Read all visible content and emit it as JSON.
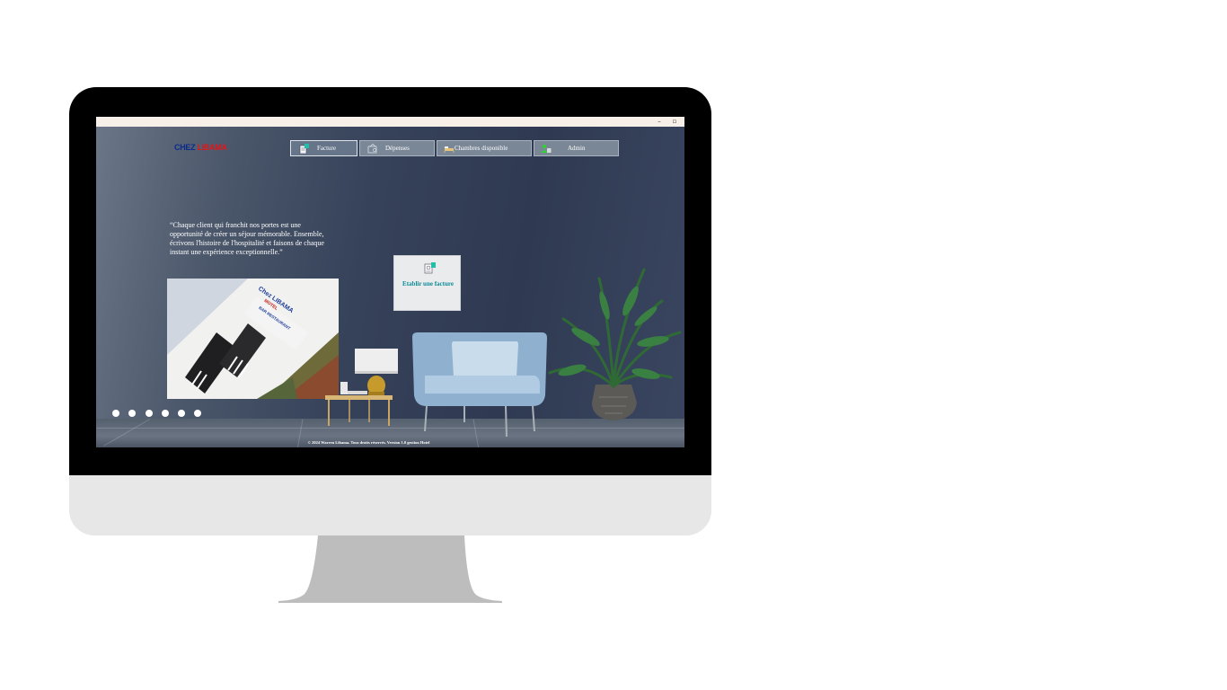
{
  "window": {
    "minimize_glyph": "–",
    "restore_glyph": "▫"
  },
  "logo": {
    "part1": "CHEZ",
    "part2": "LIBAMA"
  },
  "nav": {
    "items": [
      {
        "label": "Facture",
        "icon": "invoice-icon",
        "active": true
      },
      {
        "label": "Dépenses",
        "icon": "expenses-icon",
        "active": false
      },
      {
        "label": "Chambres disponible",
        "icon": "bed-icon",
        "active": false
      },
      {
        "label": "Admin",
        "icon": "admin-icon",
        "active": false
      }
    ]
  },
  "quote": {
    "text": "“Chaque client qui franchit nos portes est une opportunité de créer un séjour mémorable. Ensemble, écrivons l'histoire de l'hospitalité et faisons de chaque instant une expérience exceptionnelle.”"
  },
  "photo": {
    "sign_line1": "Chez LIBAMA",
    "sign_line2": "MOTEL",
    "sign_line3": "BAR RESTAURANT"
  },
  "carousel": {
    "dot_count": 6
  },
  "card": {
    "label": "Etablir une facture",
    "icon": "invoice-icon"
  },
  "footer": {
    "text": "© 2024 Warren Libama. Tous droits réservés. Version 1.0 gestion Hotel"
  },
  "colors": {
    "accent_teal": "#0c8a96",
    "logo_blue": "#0b2a8a",
    "logo_red": "#e0161b"
  }
}
